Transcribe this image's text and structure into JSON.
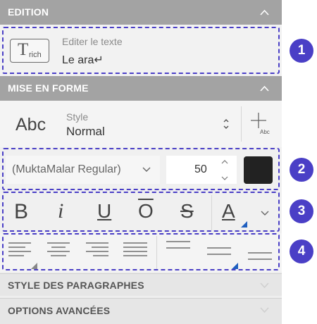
{
  "sections": {
    "edition": "EDITION",
    "mise_en_forme": "MISE EN FORME",
    "style_paragraphes": "STYLE DES PARAGRAPHES",
    "options_avancees": "OPTIONS AVANCÉES"
  },
  "edition": {
    "rich_icon_letter": "T",
    "rich_icon_sub": "rich",
    "label": "Editer le texte",
    "value": "Le ara↵"
  },
  "style": {
    "preview": "Abc",
    "label": "Style",
    "value": "Normal",
    "add_sub": "Abc"
  },
  "font": {
    "family": "(MuktaMalar Regular)",
    "size": "50",
    "color": "#222222"
  },
  "format_buttons": {
    "bold": "B",
    "italic": "i",
    "underline": "U",
    "overline": "O",
    "strike": "S",
    "case": "A"
  },
  "callouts": [
    "1",
    "2",
    "3",
    "4"
  ],
  "colors": {
    "accent": "#4a3fc6",
    "header": "#a3a3a3",
    "corner_marker": "#1f5fbf"
  }
}
